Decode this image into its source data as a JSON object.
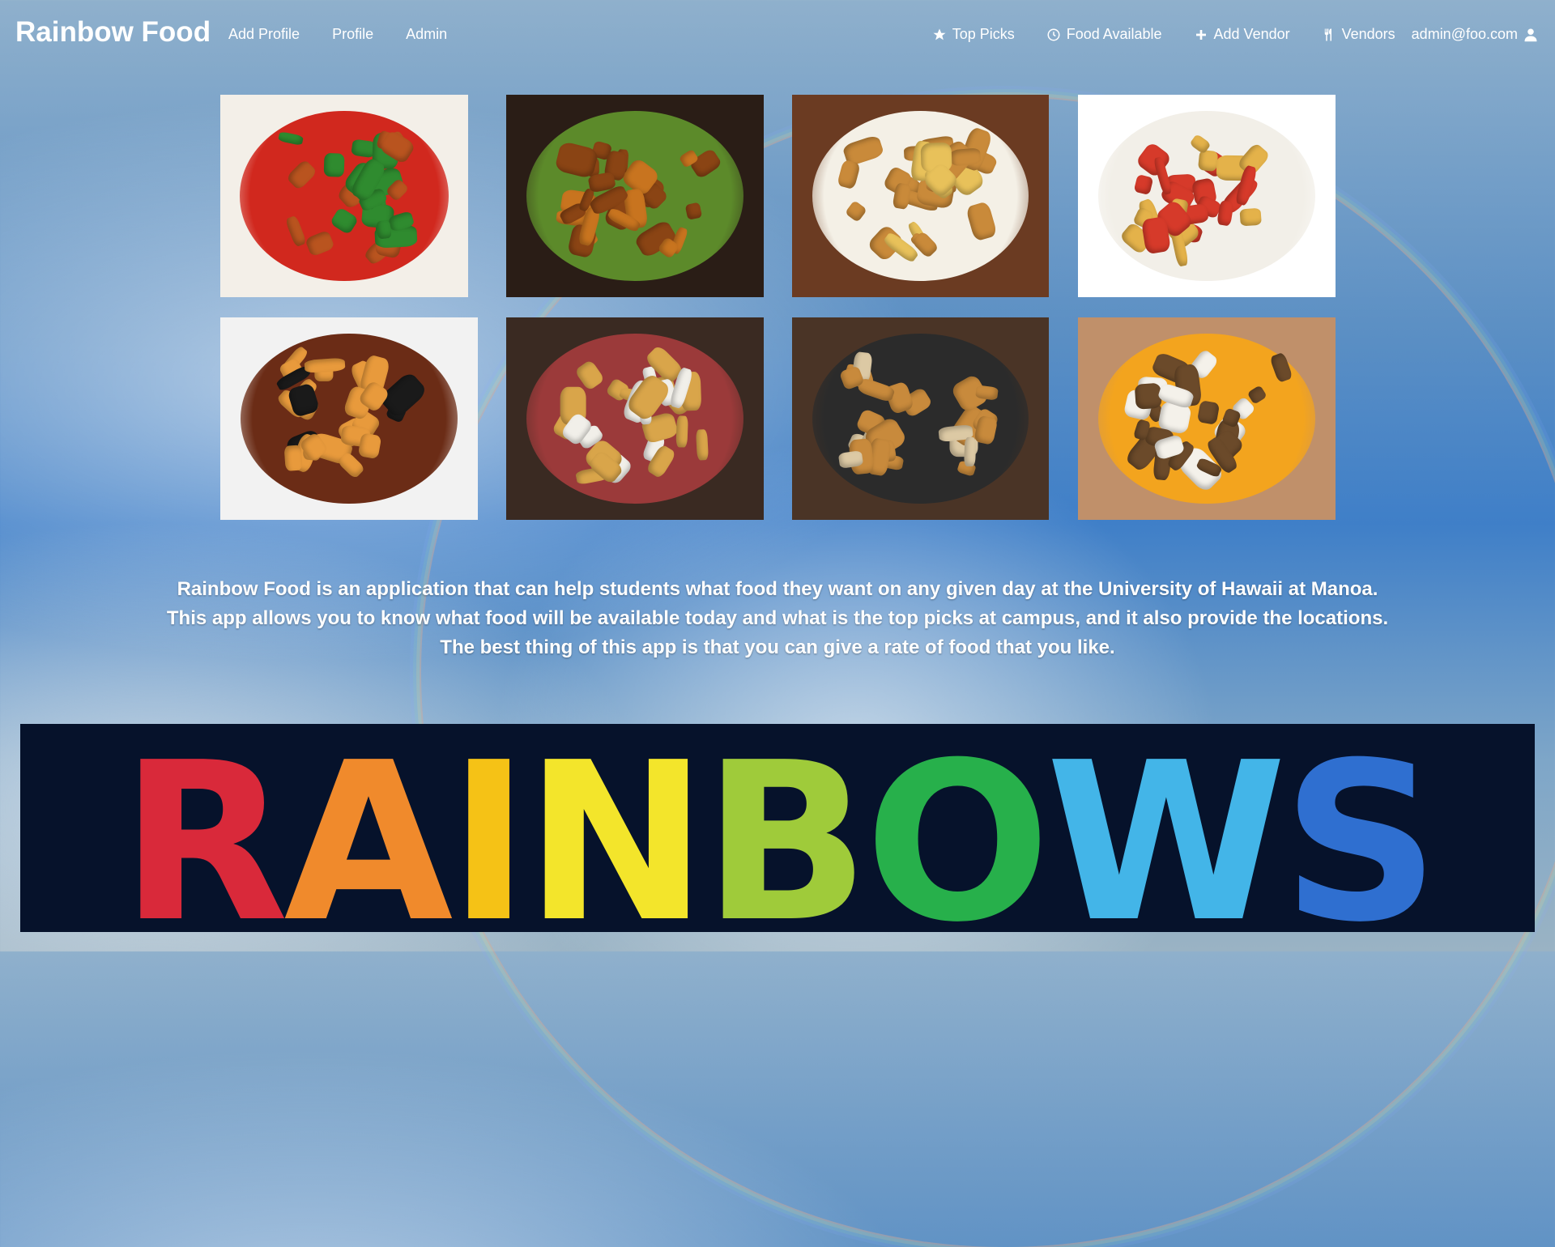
{
  "navbar": {
    "brand": "Rainbow Food",
    "left_links": [
      "Add Profile",
      "Profile",
      "Admin"
    ],
    "top_picks": "Top Picks",
    "food_available": "Food Available",
    "add_vendor": "Add Vendor",
    "vendors": "Vendors",
    "user_email": "admin@foo.com"
  },
  "description": {
    "line1": "Rainbow Food is an application that can help students what food they want on any given day at the University of Hawaii at Manoa.",
    "line2": "This app allows you to know what food will be available today and what is the top picks at campus, and it also provide the locations.",
    "line3": "The best thing of this app is that you can give a rate of food that you like."
  },
  "banner": {
    "text": "RAINBOWS",
    "letter_colors": [
      "#d9293a",
      "#f08a2c",
      "#f5c216",
      "#f3e52b",
      "#9fcb3a",
      "#27b04b",
      "#43b5e8",
      "#2f6fd0",
      "#8f3ea6"
    ]
  },
  "images": [
    {
      "name": "kung-pao-chicken",
      "colors": [
        "#f3efe8",
        "#b9541f",
        "#2f8b2f",
        "#d1281e"
      ]
    },
    {
      "name": "orange-chicken",
      "colors": [
        "#2a1d16",
        "#c8741f",
        "#8a4414",
        "#5c8a2a"
      ]
    },
    {
      "name": "burger-and-fries",
      "colors": [
        "#6b3b22",
        "#e8c15a",
        "#c98a3a",
        "#f4f0e6"
      ]
    },
    {
      "name": "loaded-fries",
      "colors": [
        "#ffffff",
        "#e4b24a",
        "#d63a2a",
        "#f2efe8"
      ]
    },
    {
      "name": "shrimp-and-beef-bowl",
      "colors": [
        "#f2f2f2",
        "#1a1a1a",
        "#e89a3c",
        "#6b2c16"
      ]
    },
    {
      "name": "steak-and-fries",
      "colors": [
        "#3a2a22",
        "#f1efe9",
        "#d9a54a",
        "#9b3a3a"
      ]
    },
    {
      "name": "chicken-katsu",
      "colors": [
        "#4a3426",
        "#dcc9a4",
        "#c88a3c",
        "#2b2b2b"
      ]
    },
    {
      "name": "loco-moco",
      "colors": [
        "#c0906a",
        "#f4f1ea",
        "#6b4a2a",
        "#f3a41e"
      ]
    }
  ]
}
